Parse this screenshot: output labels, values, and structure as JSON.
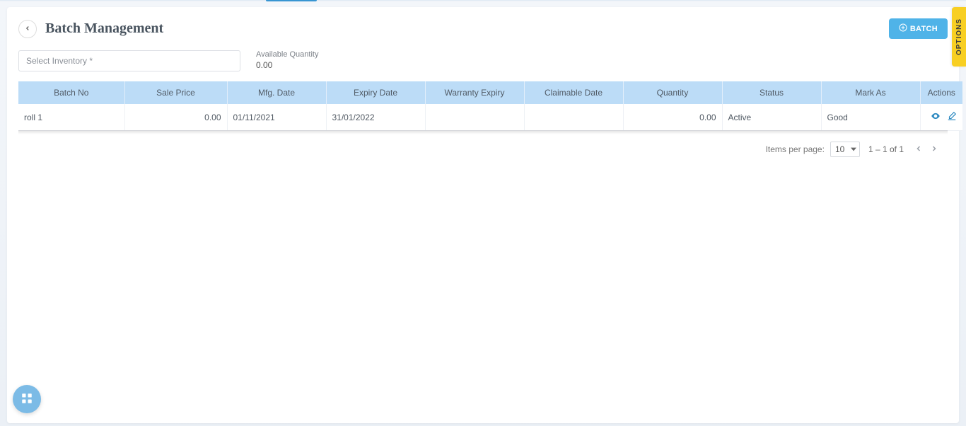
{
  "header": {
    "title": "Batch Management",
    "batch_button_label": "BATCH"
  },
  "filters": {
    "select_inventory_placeholder": "Select Inventory *",
    "available_qty_label": "Available Quantity",
    "available_qty_value": "0.00"
  },
  "table": {
    "columns": {
      "batch_no": "Batch No",
      "sale_price": "Sale Price",
      "mfg_date": "Mfg. Date",
      "expiry_date": "Expiry Date",
      "warranty_expiry": "Warranty Expiry",
      "claimable_date": "Claimable Date",
      "quantity": "Quantity",
      "status": "Status",
      "mark_as": "Mark As",
      "actions": "Actions"
    },
    "rows": [
      {
        "batch_no": "roll 1",
        "sale_price": "0.00",
        "mfg_date": "01/11/2021",
        "expiry_date": "31/01/2022",
        "warranty_expiry": "",
        "claimable_date": "",
        "quantity": "0.00",
        "status": "Active",
        "mark_as": "Good"
      }
    ]
  },
  "pagination": {
    "items_per_page_label": "Items per page:",
    "items_per_page_value": "10",
    "range_text": "1 – 1 of 1"
  },
  "sidebar": {
    "options_label": "OPTIONS"
  },
  "icons": {
    "plus": "plus-icon",
    "back": "chevron-left-icon",
    "eye": "eye-icon",
    "edit": "edit-icon",
    "apps": "apps-icon"
  }
}
